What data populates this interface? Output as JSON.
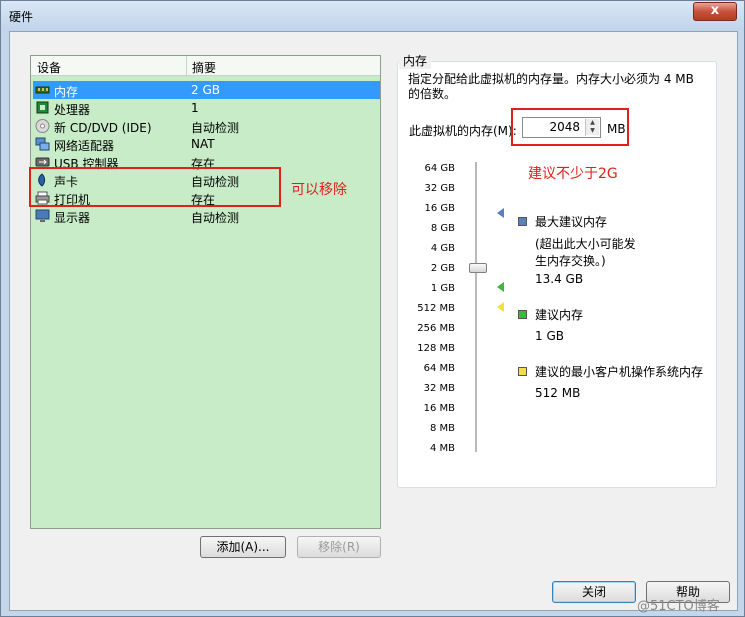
{
  "window": {
    "title": "硬件",
    "close_glyph": "x"
  },
  "device_list": {
    "headers": {
      "device": "设备",
      "summary": "摘要"
    },
    "rows": [
      {
        "device": "内存",
        "summary": "2 GB",
        "icon": "memory-icon"
      },
      {
        "device": "处理器",
        "summary": "1",
        "icon": "processor-icon"
      },
      {
        "device": "新 CD/DVD (IDE)",
        "summary": "自动检测",
        "icon": "cd-dvd-icon"
      },
      {
        "device": "网络适配器",
        "summary": "NAT",
        "icon": "network-adapter-icon"
      },
      {
        "device": "USB 控制器",
        "summary": "存在",
        "icon": "usb-icon"
      },
      {
        "device": "声卡",
        "summary": "自动检测",
        "icon": "sound-card-icon"
      },
      {
        "device": "打印机",
        "summary": "存在",
        "icon": "printer-icon"
      },
      {
        "device": "显示器",
        "summary": "自动检测",
        "icon": "display-icon"
      }
    ],
    "selected_index": 0
  },
  "buttons": {
    "add": "添加(A)...",
    "remove": "移除(R)",
    "close": "关闭",
    "help": "帮助"
  },
  "memory": {
    "group_title": "内存",
    "description": "指定分配给此虚拟机的内存量。内存大小必须为 4 MB 的倍数。",
    "field_label": "此虚拟机的内存(M):",
    "value": "2048",
    "unit": "MB",
    "ticks": [
      "64 GB",
      "32 GB",
      "16 GB",
      "8 GB",
      "4 GB",
      "2 GB",
      "1 GB",
      "512 MB",
      "256 MB",
      "128 MB",
      "64 MB",
      "32 MB",
      "16 MB",
      "8 MB",
      "4 MB"
    ],
    "max_recommended": {
      "title": "最大建议内存",
      "note": "(超出此大小可能发生内存交换。)",
      "value": "13.4 GB",
      "color": "#5b7fbf"
    },
    "recommended": {
      "title": "建议内存",
      "value": "1 GB",
      "color": "#3cb83c"
    },
    "min_guest": {
      "title": "建议的最小客户机操作系统内存",
      "value": "512 MB",
      "color": "#f0e040"
    }
  },
  "annotations": {
    "removable": "可以移除",
    "advice": "建议不少于2G"
  },
  "watermark": "@51CTO博客"
}
